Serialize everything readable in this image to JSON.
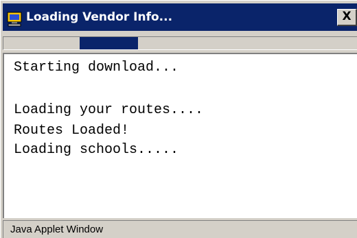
{
  "window": {
    "title": "Loading Vendor Info...",
    "title_icon": "computer-icon",
    "close_label": "X",
    "title_bar_color": "#0a246a",
    "chrome_color": "#d4d0c8"
  },
  "progress": {
    "fill_color": "#0a246a"
  },
  "console": {
    "lines": [
      "Starting download...",
      "",
      "Loading your routes....",
      "Routes Loaded!",
      "Loading schools....."
    ]
  },
  "status": {
    "text": "Java Applet Window"
  }
}
